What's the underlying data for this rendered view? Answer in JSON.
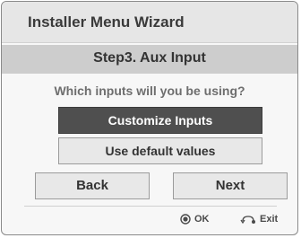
{
  "dialog": {
    "title": "Installer Menu Wizard",
    "step_title": "Step3. Aux Input",
    "question": "Which inputs will you be using?",
    "options": [
      {
        "label": "Customize Inputs",
        "selected": true
      },
      {
        "label": "Use default values",
        "selected": false
      }
    ],
    "back_label": "Back",
    "next_label": "Next",
    "hints": {
      "ok_label": "OK",
      "ok_icon": "ok-button-icon",
      "exit_label": "Exit",
      "exit_icon": "return-arrow-icon"
    }
  }
}
